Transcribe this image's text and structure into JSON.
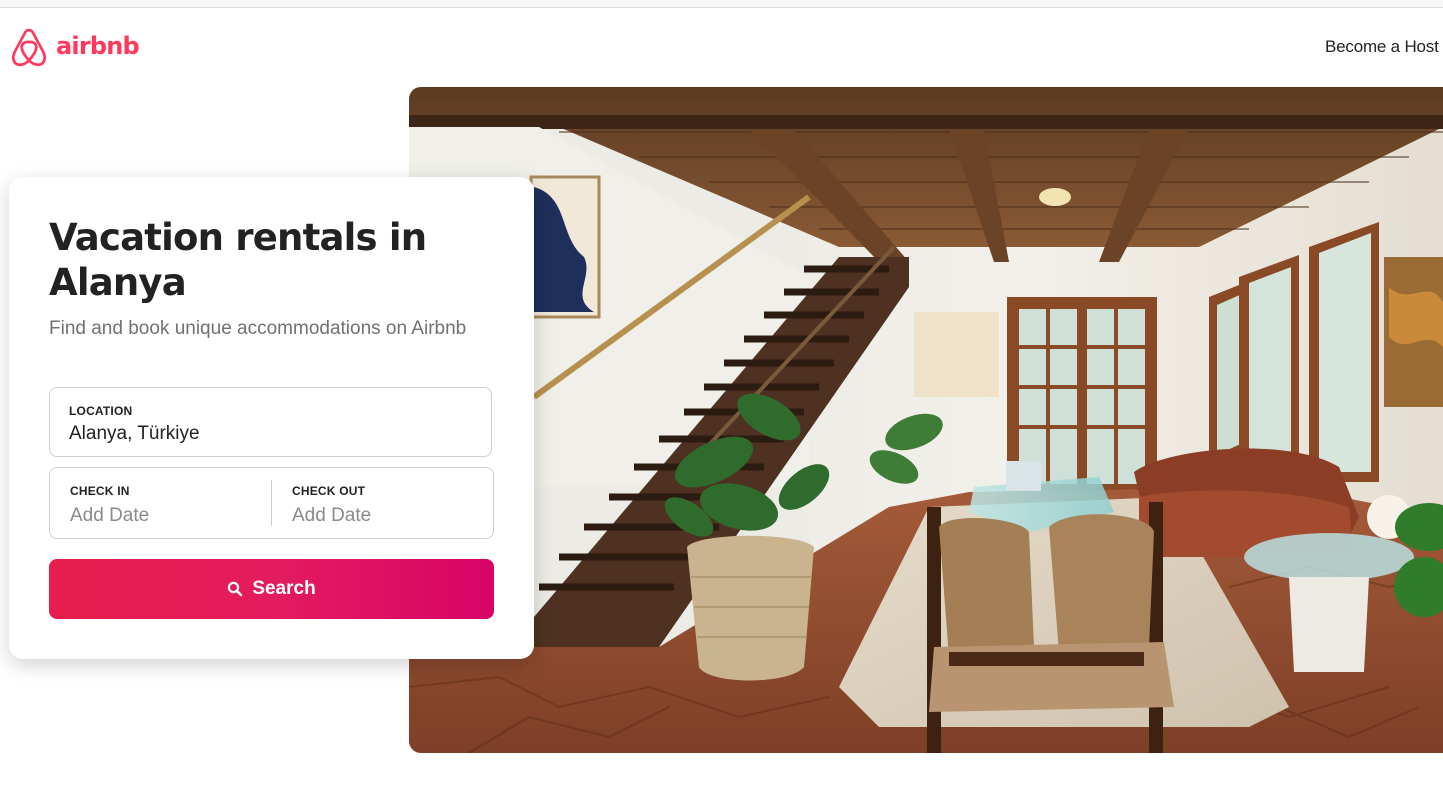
{
  "header": {
    "logo_text": "airbnb",
    "host_link": "Become a Host"
  },
  "hero": {
    "title": "Vacation rentals in Alanya",
    "subtitle": "Find and book unique accommodations on Airbnb"
  },
  "search_form": {
    "location": {
      "label": "LOCATION",
      "value": "Alanya, Türkiye"
    },
    "check_in": {
      "label": "CHECK IN",
      "placeholder": "Add Date"
    },
    "check_out": {
      "label": "CHECK OUT",
      "placeholder": "Add Date"
    },
    "search_button": "Search"
  },
  "colors": {
    "brand": "#ff385c",
    "button_gradient_start": "#e61e4d",
    "button_gradient_end": "#d70466",
    "text_primary": "#222222",
    "text_secondary": "#717171"
  },
  "icons": {
    "logo": "airbnb-belo-icon",
    "search": "search-icon"
  }
}
